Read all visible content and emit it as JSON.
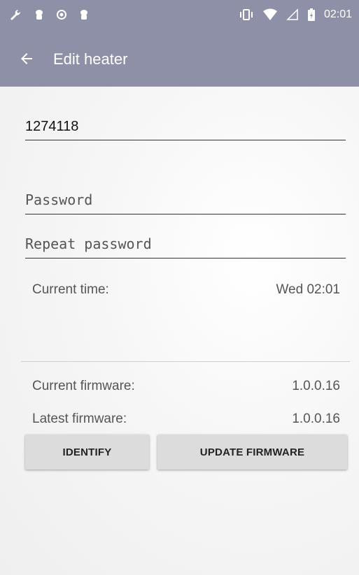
{
  "status_bar": {
    "icons_left": [
      "wrench-icon",
      "android-debug-icon",
      "record-icon",
      "android-debug-icon"
    ],
    "icons_right": [
      "vibrate-icon",
      "wifi-icon",
      "signal-icon",
      "battery-charging-icon"
    ],
    "time": "02:01"
  },
  "toolbar": {
    "title": "Edit heater",
    "back_icon": "arrow-back-icon"
  },
  "form": {
    "heater_id": "1274118",
    "password_placeholder": "Password",
    "repeat_password_placeholder": "Repeat password"
  },
  "info": {
    "current_time_label": "Current time:",
    "current_time_value": "Wed 02:01",
    "current_firmware_label": "Current firmware:",
    "current_firmware_value": "1.0.0.16",
    "latest_firmware_label": "Latest firmware:",
    "latest_firmware_value": "1.0.0.16"
  },
  "buttons": {
    "identify": "IDENTIFY",
    "update_firmware": "UPDATE FIRMWARE"
  },
  "colors": {
    "app_bar": "#8e90a8",
    "button_bg": "#dcdcdc"
  }
}
